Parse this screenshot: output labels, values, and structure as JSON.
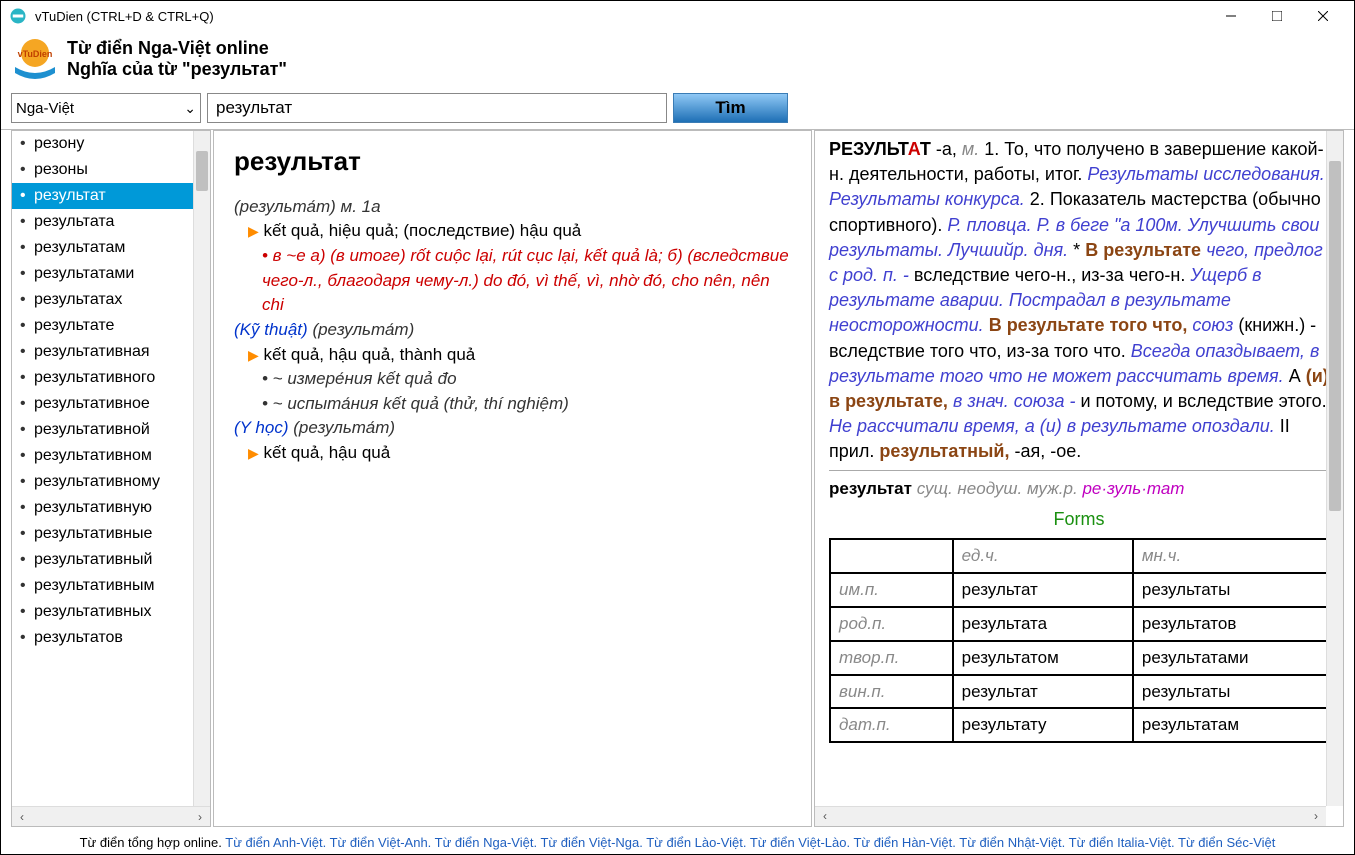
{
  "window": {
    "title": "vTuDien (CTRL+D & CTRL+Q)"
  },
  "header": {
    "title1": "Từ điển Nga-Việt online",
    "title2": "Nghĩa của từ \"результат\""
  },
  "search": {
    "lang": "Nga-Việt",
    "query": "результат",
    "button": "Tìm"
  },
  "sidebar": {
    "items": [
      "резону",
      "резоны",
      "результат",
      "результата",
      "результатам",
      "результатами",
      "результатах",
      "результате",
      "результативная",
      "результативного",
      "результативное",
      "результативной",
      "результативном",
      "результативному",
      "результативную",
      "результативные",
      "результативный",
      "результативным",
      "результативных",
      "результатов"
    ],
    "activeIndex": 2
  },
  "entry": {
    "headword": "результат",
    "pron": "(результа́т)",
    "gram_abbr": "м.",
    "class": "1a",
    "senses": [
      {
        "gloss": "kết quả, hiệu quả; (последствие) hậu quả"
      }
    ],
    "sub1": "• в ~е a) (в итоге) rốt cuộc lại, rút cục lại, kết quả là; б) (вследствие чего-л., благодаря чему-л.) do đó, vì thế, vì, nhờ đó, cho nên, nên chi",
    "tech_label": "(Kỹ thuật)",
    "tech_pron": "(результа́т)",
    "tech_gloss": "kết quả, hậu quả, thành quả",
    "tech_sub1": "• ~ измере́ния kết quả đo",
    "tech_sub2": "• ~ испыта́ния kết quả (thử, thí nghiệm)",
    "med_label": "(Y học)",
    "med_pron": "(результа́т)",
    "med_gloss": "kết quả, hậu quả"
  },
  "right": {
    "headword_pre": "РЕЗУЛЬТ",
    "headword_stress": "А",
    "headword_post": "Т",
    "ending": "-а,",
    "gender": "м.",
    "def1_num": "1.",
    "def1": "То, что получено в завершение какой-н. деятельности, работы, итог.",
    "ex1": "Результаты исследования. Результаты конкурса.",
    "def2_num": "2.",
    "def2": "Показатель мастерства (обычно спортивного).",
    "ex2": "Р. пловца. Р. в беге \"а 100м. Улучшить свои результаты. Лучшийр. дня.",
    "star": "*",
    "phrase1": "В результате",
    "phrase1_after": "чего, предлог с род. п. -",
    "phrase1_def": "вследствие чего-н., из-за чего-н.",
    "phrase1_ex": "Ущерб в результате аварии. Пострадал в результате неосторожности.",
    "phrase2": "В результате того что,",
    "phrase2_gram": "союз",
    "phrase2_note": "(книжн.) -",
    "phrase2_def": "вследствие того что, из-за того что.",
    "phrase2_ex": "Всегда опаздывает, в результате того что не может рассчитать время.",
    "phrase3_pre": "А",
    "phrase3": "(и) в результате,",
    "phrase3_gram": "в знач. союза -",
    "phrase3_def": "и потому, и вследствие этого.",
    "phrase3_ex": "Не рассчитали время, а (и) в результате опоздали.",
    "adj_marker": "II прил.",
    "adj": "результатный,",
    "adj_end": "-ая, -ое.",
    "form_head": "результат",
    "form_gram": "сущ. неодуш. муж.р.",
    "syll": "ре·зуль·тат",
    "forms_title": "Forms",
    "forms_head_sg": "ед.ч.",
    "forms_head_pl": "мн.ч.",
    "forms": [
      {
        "case": "им.п.",
        "sg": "результат",
        "pl": "результаты"
      },
      {
        "case": "род.п.",
        "sg": "результата",
        "pl": "результатов"
      },
      {
        "case": "твор.п.",
        "sg": "результатом",
        "pl": "результатами"
      },
      {
        "case": "вин.п.",
        "sg": "результат",
        "pl": "результаты"
      },
      {
        "case": "дат.п.",
        "sg": "результату",
        "pl": "результатам"
      }
    ]
  },
  "footer": {
    "prefix": "Từ điển tổng hợp online.",
    "links": [
      "Từ điển Anh-Việt.",
      "Từ điển Việt-Anh.",
      "Từ điển Nga-Việt.",
      "Từ điển Việt-Nga.",
      "Từ điển Lào-Việt.",
      "Từ điển Việt-Lào.",
      "Từ điển Hàn-Việt.",
      "Từ điển Nhật-Việt.",
      "Từ điển Italia-Việt.",
      "Từ điển Séc-Việt"
    ]
  }
}
